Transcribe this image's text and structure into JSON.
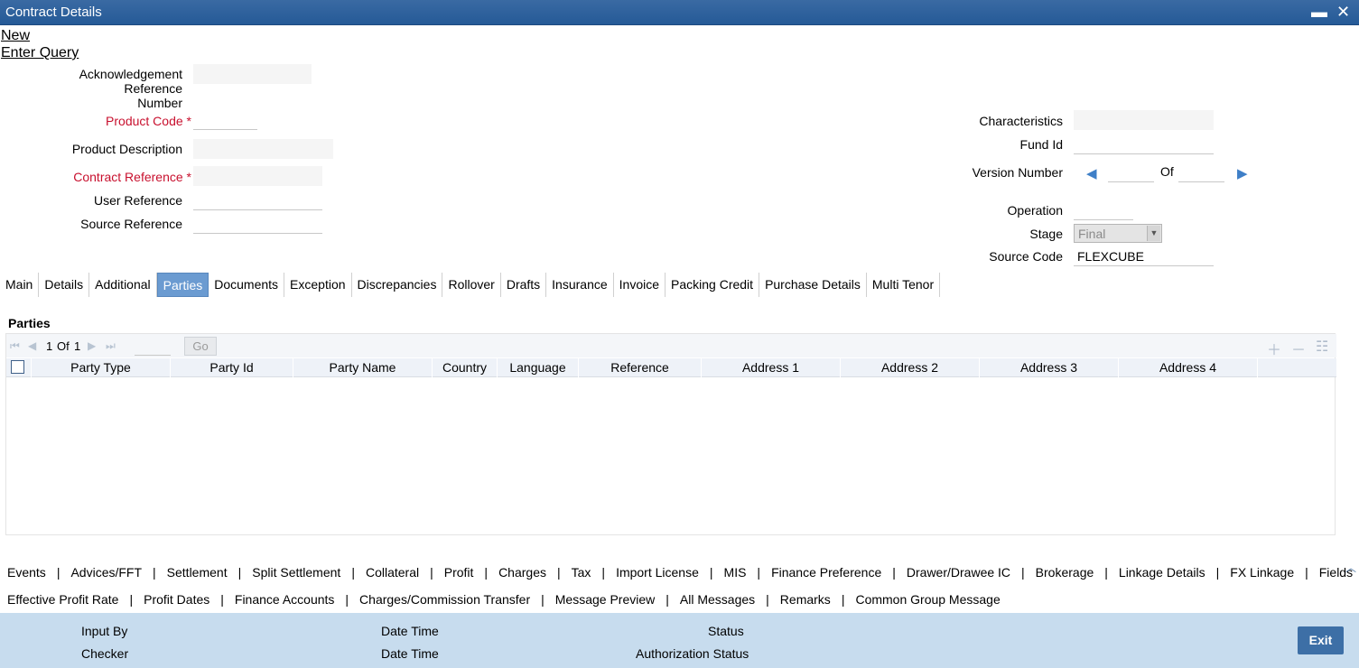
{
  "window": {
    "title": "Contract Details",
    "minimize_label": "▬",
    "close_label": "✕"
  },
  "actions": {
    "new_label": "New",
    "enter_query_label": "Enter Query"
  },
  "form": {
    "ack_ref_label_1": "Acknowledgement Reference",
    "ack_ref_label_2": "Number",
    "product_code_label": "Product Code",
    "product_desc_label": "Product Description",
    "contract_ref_label": "Contract Reference",
    "user_ref_label": "User Reference",
    "source_ref_label": "Source Reference",
    "characteristics_label": "Characteristics",
    "fund_id_label": "Fund Id",
    "version_number_label": "Version Number",
    "of_label": "Of",
    "operation_label": "Operation",
    "stage_label": "Stage",
    "stage_value": "Final",
    "source_code_label": "Source Code",
    "source_code_value": "FLEXCUBE",
    "required_mark": "*"
  },
  "tabs": [
    {
      "label": "Main"
    },
    {
      "label": "Details"
    },
    {
      "label": "Additional"
    },
    {
      "label": "Parties",
      "active": true
    },
    {
      "label": "Documents"
    },
    {
      "label": "Exception"
    },
    {
      "label": "Discrepancies"
    },
    {
      "label": "Rollover"
    },
    {
      "label": "Drafts"
    },
    {
      "label": "Insurance"
    },
    {
      "label": "Invoice"
    },
    {
      "label": "Packing Credit"
    },
    {
      "label": "Purchase Details"
    },
    {
      "label": "Multi Tenor"
    }
  ],
  "parties": {
    "title": "Parties",
    "page_current": "1",
    "page_of": "Of",
    "page_total": "1",
    "go_label": "Go",
    "columns": [
      "Party Type",
      "Party Id",
      "Party Name",
      "Country",
      "Language",
      "Reference",
      "Address 1",
      "Address 2",
      "Address 3",
      "Address 4"
    ]
  },
  "bottom_links_row1": [
    "Events",
    "Advices/FFT",
    "Settlement",
    "Split Settlement",
    "Collateral",
    "Profit",
    "Charges",
    "Tax",
    "Import License",
    "MIS",
    "Finance Preference",
    "Drawer/Drawee IC",
    "Brokerage",
    "Linkage Details",
    "FX Linkage",
    "Fields"
  ],
  "bottom_links_row2": [
    "Effective Profit Rate",
    "Profit Dates",
    "Finance Accounts",
    "Charges/Commission Transfer",
    "Message Preview",
    "All Messages",
    "Remarks",
    "Common Group Message"
  ],
  "footer": {
    "input_by": "Input By",
    "checker": "Checker",
    "date_time_1": "Date Time",
    "date_time_2": "Date Time",
    "status": "Status",
    "auth_status": "Authorization Status",
    "exit_label": "Exit"
  }
}
